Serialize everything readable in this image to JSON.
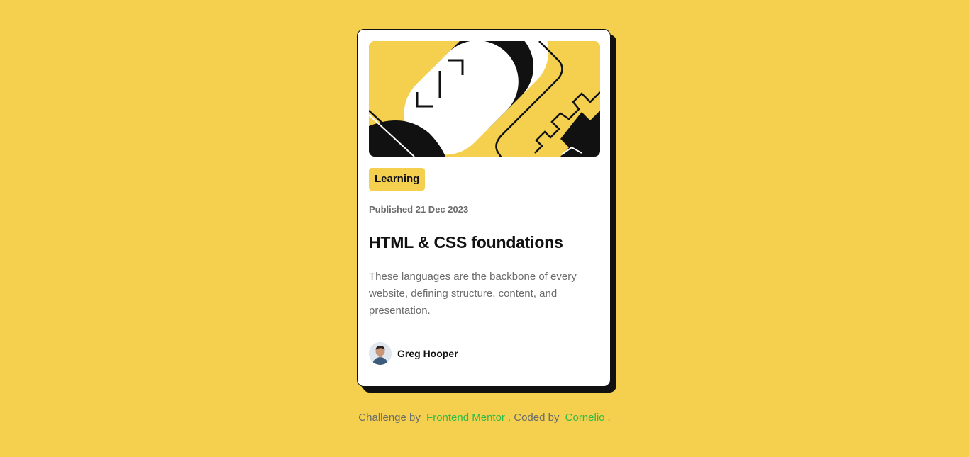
{
  "card": {
    "image_alt": "illustration-article",
    "tag": "Learning",
    "published": "Published 21 Dec 2023",
    "title": "HTML & CSS foundations",
    "description": "These languages are the backbone of every website, defining structure, content, and presentation.",
    "author": {
      "name": "Greg Hooper",
      "avatar_icon": "avatar-photo"
    }
  },
  "attribution": {
    "prefix": "Challenge by",
    "link1": "Frontend Mentor",
    "middle": ". Coded by",
    "link2": "Cornelio",
    "suffix": "."
  },
  "colors": {
    "background": "#f4d04e",
    "card": "#ffffff",
    "ink": "#111111",
    "muted": "#6b6b6b",
    "link": "#2ebb4a"
  }
}
